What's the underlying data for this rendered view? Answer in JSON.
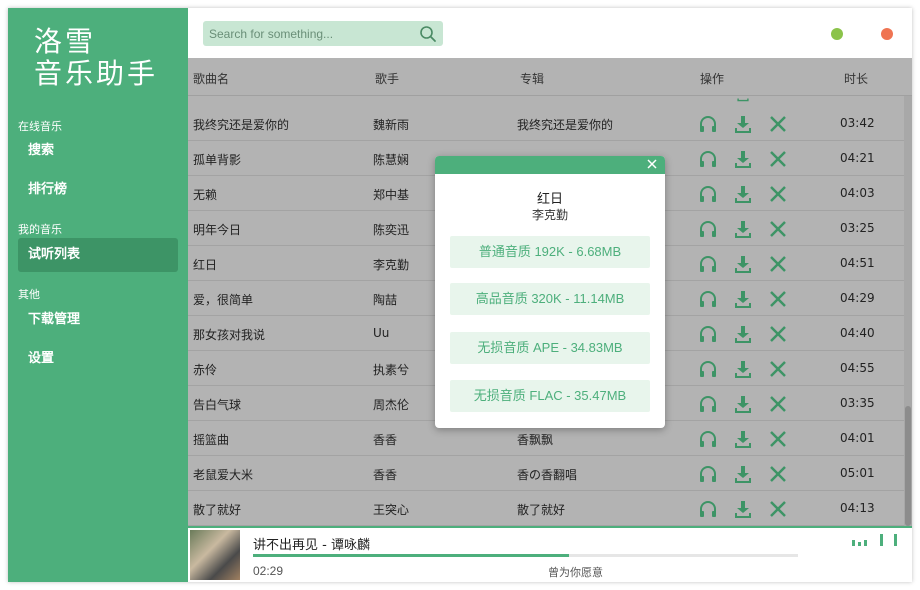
{
  "app": {
    "logo_line1": "洛雪",
    "logo_line2": "音乐助手"
  },
  "sidebar": {
    "section_online": "在线音乐",
    "item_search": "搜索",
    "item_charts": "排行榜",
    "section_mine": "我的音乐",
    "item_playlist": "试听列表",
    "section_other": "其他",
    "item_downloads": "下载管理",
    "item_settings": "设置"
  },
  "search": {
    "placeholder": "Search for something..."
  },
  "table": {
    "headers": {
      "name": "歌曲名",
      "artist": "歌手",
      "album": "专辑",
      "ops": "操作",
      "duration": "时长"
    },
    "rows": [
      {
        "name": "我终究还是爱你的",
        "artist": "魏新雨",
        "album": "我终究还是爱你的",
        "duration": "03:42"
      },
      {
        "name": "孤单背影",
        "artist": "陈慧娴",
        "album": "",
        "duration": "04:21"
      },
      {
        "name": "无赖",
        "artist": "郑中基",
        "album": "",
        "duration": "04:03"
      },
      {
        "name": "明年今日",
        "artist": "陈奕迅",
        "album": "",
        "duration": "03:25"
      },
      {
        "name": "红日",
        "artist": "李克勤",
        "album": "",
        "duration": "04:51"
      },
      {
        "name": "爱，很简单",
        "artist": "陶喆",
        "album": "",
        "duration": "04:29"
      },
      {
        "name": "那女孩对我说",
        "artist": "Uu",
        "album": "",
        "duration": "04:40"
      },
      {
        "name": "赤伶",
        "artist": "执素兮",
        "album": "",
        "duration": "04:55"
      },
      {
        "name": "告白气球",
        "artist": "周杰伦",
        "album": "",
        "duration": "03:35"
      },
      {
        "name": "摇篮曲",
        "artist": "香香",
        "album": "香飘飘",
        "duration": "04:01"
      },
      {
        "name": "老鼠爱大米",
        "artist": "香香",
        "album": "香の香翻唱",
        "duration": "05:01"
      },
      {
        "name": "散了就好",
        "artist": "王突心",
        "album": "散了就好",
        "duration": "04:13"
      }
    ]
  },
  "modal": {
    "title": "红日",
    "artist": "李克勤",
    "options": [
      "普通音质 192K - 6.68MB",
      "高品音质 320K - 11.14MB",
      "无损音质 APE - 34.83MB",
      "无损音质 FLAC - 35.47MB"
    ]
  },
  "player": {
    "now_playing": "讲不出再见 - 谭咏麟",
    "current_time": "02:29",
    "lyric": "曾为你愿意",
    "progress": 0.58
  },
  "colors": {
    "accent": "#4daf7c",
    "accent_dark": "#3d9466",
    "dot_green": "#8bc34a",
    "dot_red": "#ef7452"
  },
  "icons": {
    "search": "search-icon",
    "listen": "headphones-icon",
    "download": "download-icon",
    "remove": "close-icon"
  }
}
